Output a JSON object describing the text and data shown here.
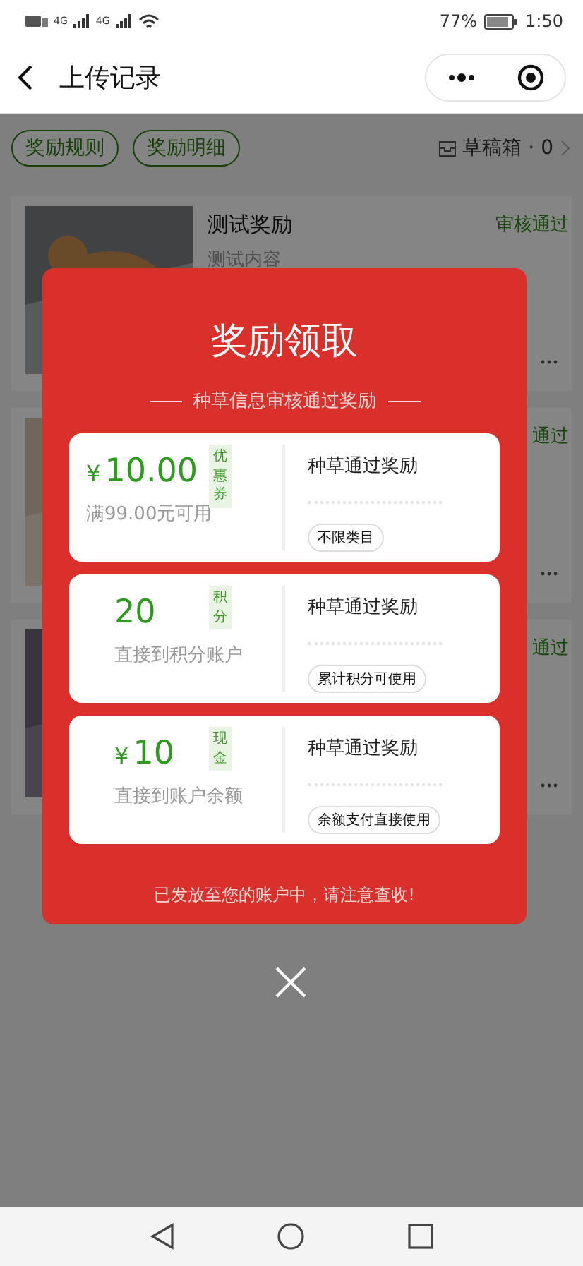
{
  "status_bar": {
    "network_1": "4G",
    "network_2": "4G",
    "battery": "77%",
    "time": "1:50"
  },
  "nav": {
    "title": "上传记录"
  },
  "filters": [
    {
      "label": "奖励规则"
    },
    {
      "label": "奖励明细"
    }
  ],
  "drafts": "草稿箱 · 0",
  "records": [
    {
      "title": "测试奖励",
      "content": "测试内容",
      "status": "审核通过",
      "kind": "picture"
    },
    {
      "status": "通过",
      "kind": "picture"
    },
    {
      "status": "通过",
      "kind": "picture"
    }
  ],
  "modal": {
    "title": "奖励领取",
    "subtitle": "种草信息审核通过奖励",
    "rewards": [
      {
        "kind": "coupon",
        "currency": "¥",
        "amount": "10.00",
        "tag": "优惠券",
        "note": "满99.00元可用",
        "name": "种草通过奖励",
        "scope": "不限类目"
      },
      {
        "kind": "points",
        "amount": "20",
        "tag": "积分",
        "note": "直接到积分账户",
        "name": "种草通过奖励",
        "scope": "累计积分可使用"
      },
      {
        "kind": "cash",
        "currency": "¥",
        "amount": "10",
        "tag": "现金",
        "note": "直接到账户余额",
        "name": "种草通过奖励",
        "scope": "余额支付直接使用"
      }
    ],
    "footer": "已发放至您的账户中，请注意查收!"
  }
}
